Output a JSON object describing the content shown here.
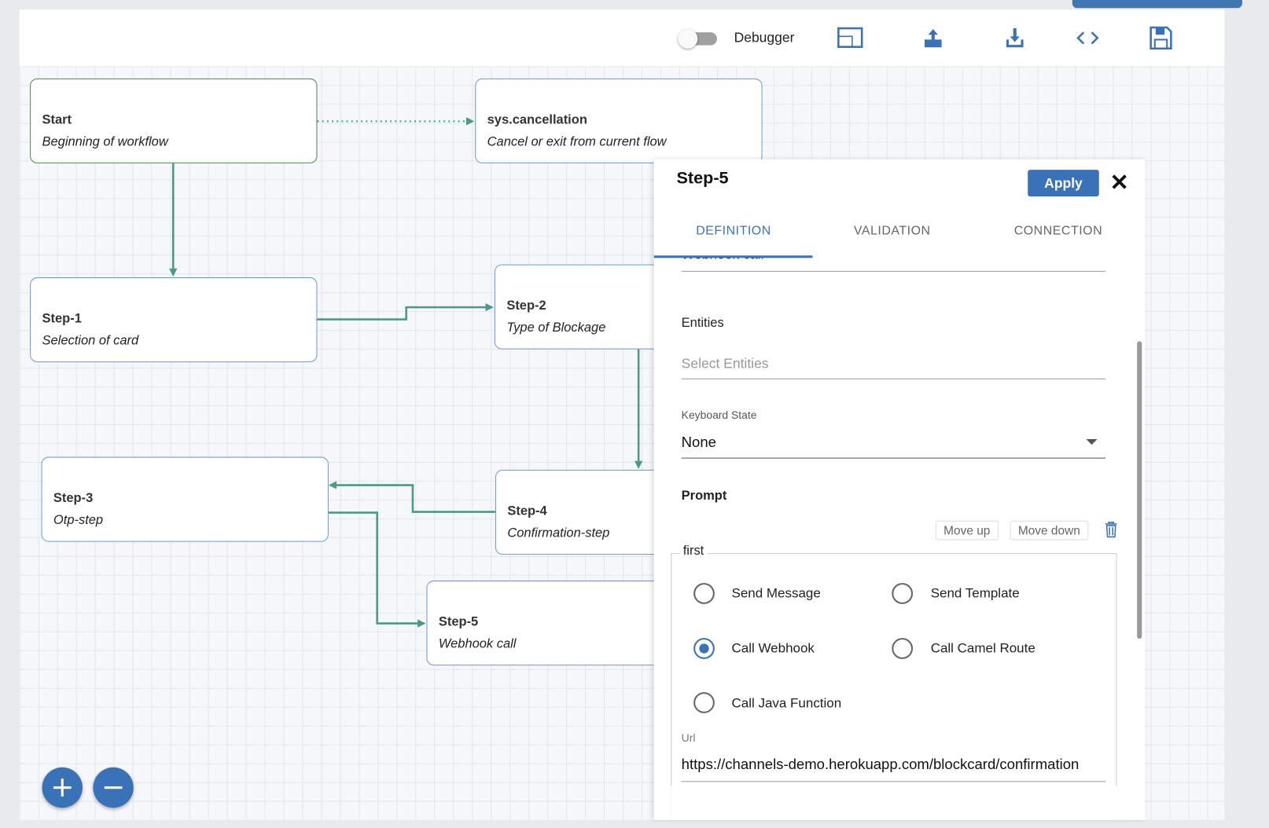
{
  "toolbar": {
    "debugger_label": "Debugger",
    "debugger_on": false,
    "icons": [
      "layout-icon",
      "upload-icon",
      "download-icon",
      "code-icon",
      "save-icon"
    ]
  },
  "nodes": [
    {
      "title": "Start",
      "subtitle": "Beginning of workflow"
    },
    {
      "title": "sys.cancellation",
      "subtitle": "Cancel or exit from current flow"
    },
    {
      "title": "Step-1",
      "subtitle": "Selection of card"
    },
    {
      "title": "Step-2",
      "subtitle": "Type of Blockage"
    },
    {
      "title": "Step-3",
      "subtitle": "Otp-step"
    },
    {
      "title": "Step-4",
      "subtitle": "Confirmation-step"
    },
    {
      "title": "Step-5",
      "subtitle": "Webhook call"
    }
  ],
  "colors": {
    "accent": "#3a72b8",
    "edge": "#4a9a8a",
    "start_border": "#4a8c4a"
  },
  "zoom": {
    "in": "+",
    "out": "−"
  },
  "panel": {
    "title": "Step-5",
    "apply": "Apply",
    "close": "✕",
    "tabs": [
      "DEFINITION",
      "VALIDATION",
      "CONNECTION"
    ],
    "active_tab": "DEFINITION",
    "description_value": "Webhook call",
    "entities_label": "Entities",
    "entities_placeholder": "Select Entities",
    "keyboard_label": "Keyboard State",
    "keyboard_value": "None",
    "prompt_label": "Prompt",
    "move_up": "Move up",
    "move_down": "Move down",
    "group_legend": "first",
    "options": [
      "Send Message",
      "Send Template",
      "Call Webhook",
      "Call Camel Route",
      "Call Java Function"
    ],
    "selected_option": "Call Webhook",
    "url_label": "Url",
    "url_value": "https://channels-demo.herokuapp.com/blockcard/confirmation"
  }
}
